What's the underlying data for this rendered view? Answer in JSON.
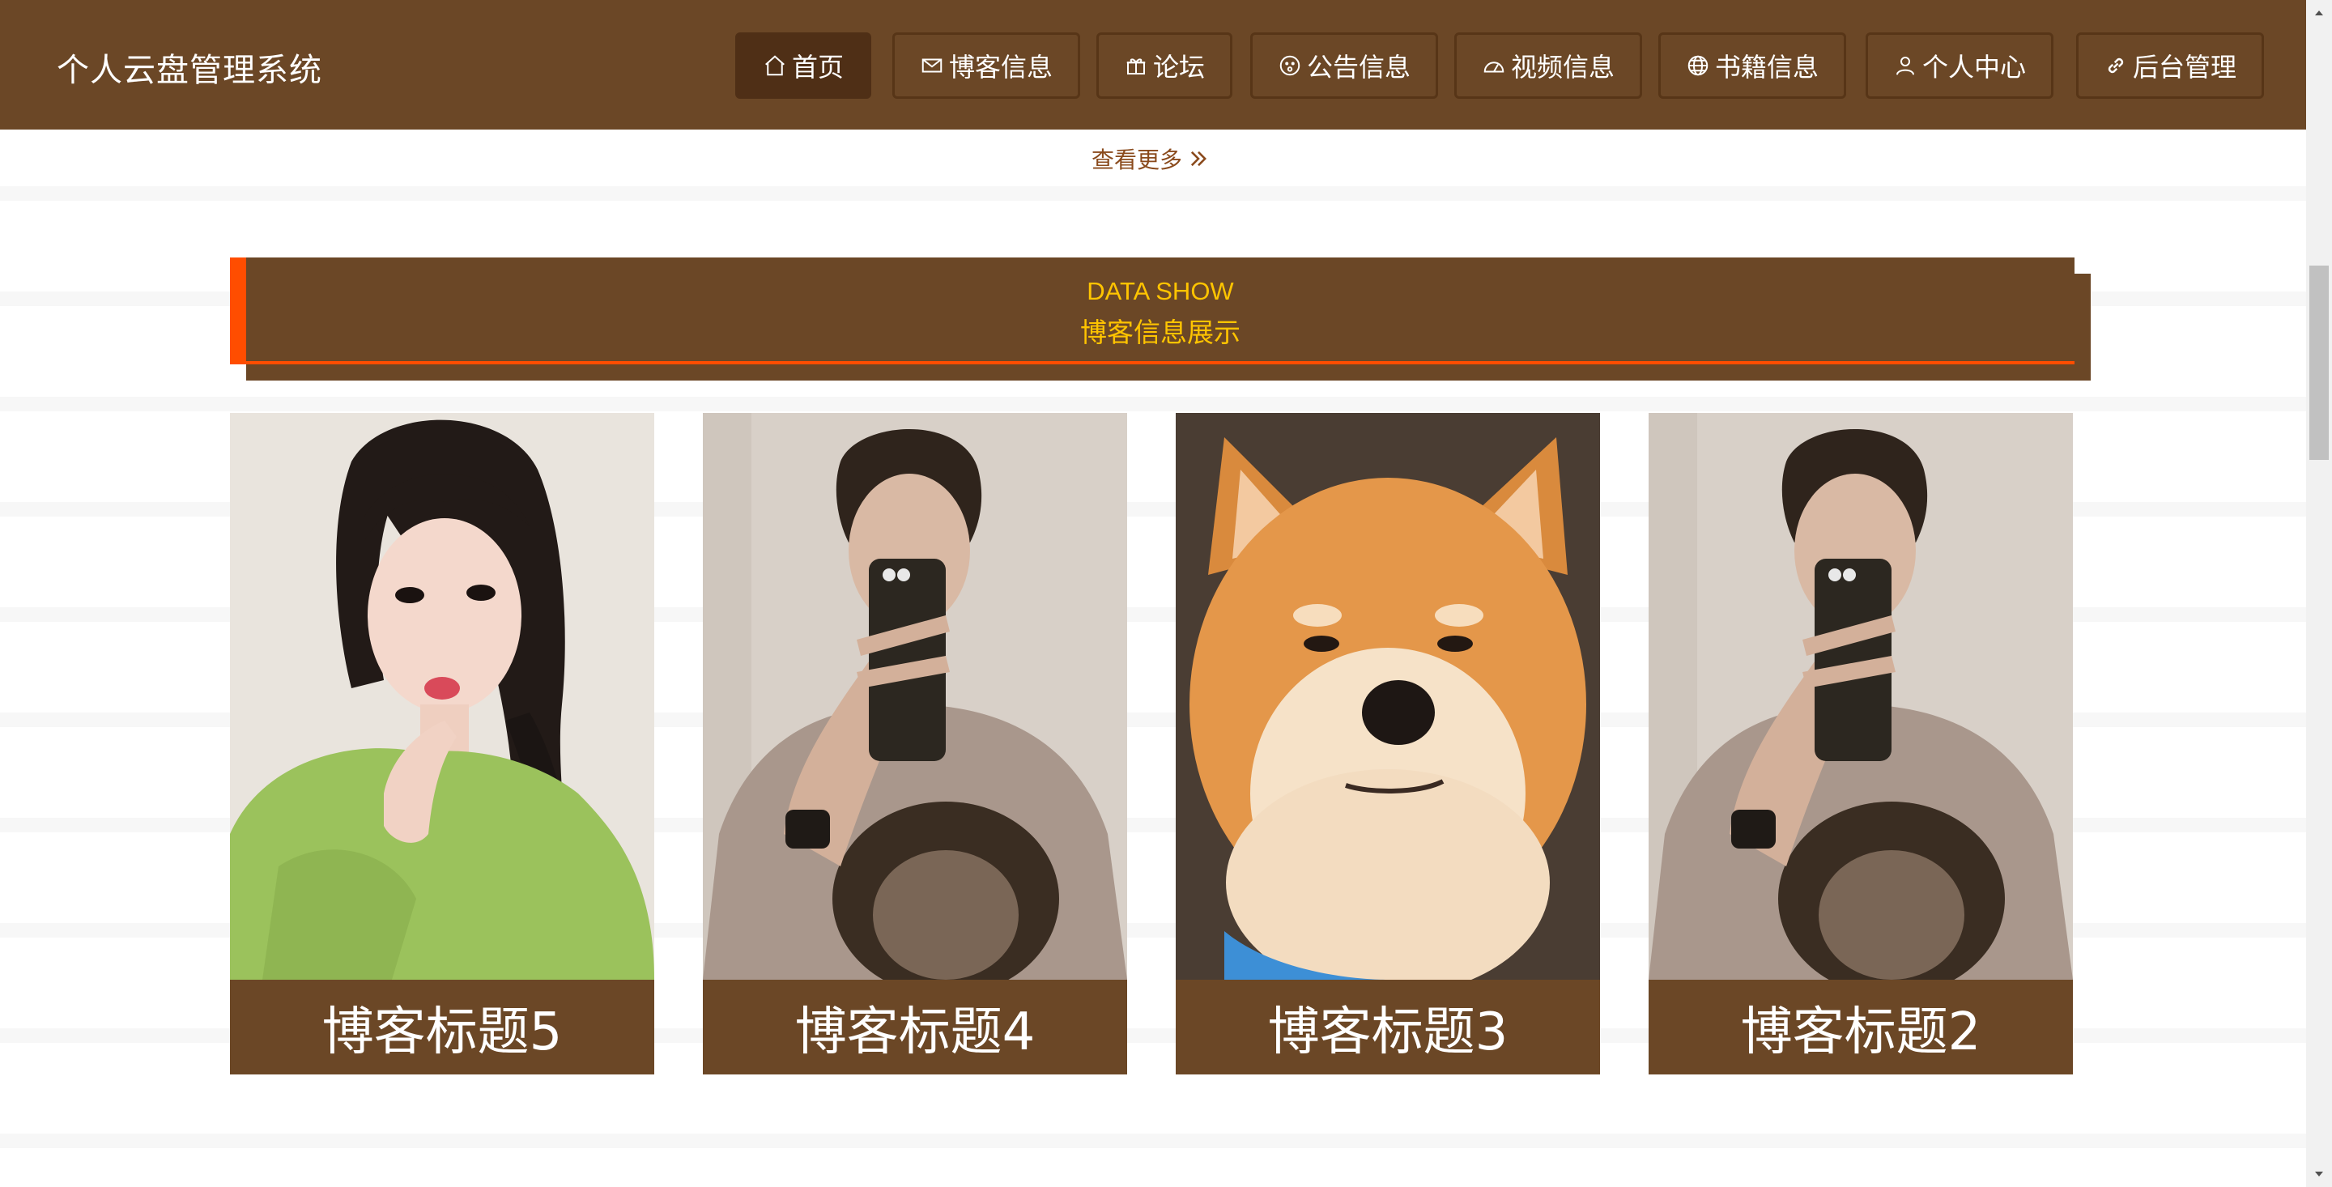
{
  "app": {
    "title": "个人云盘管理系统"
  },
  "nav": {
    "items": [
      {
        "label": "首页",
        "icon": "home-icon",
        "active": true
      },
      {
        "label": "博客信息",
        "icon": "mail-icon",
        "active": false
      },
      {
        "label": "论坛",
        "icon": "gift-icon",
        "active": false
      },
      {
        "label": "公告信息",
        "icon": "smile-icon",
        "active": false
      },
      {
        "label": "视频信息",
        "icon": "dashboard-icon",
        "active": false
      },
      {
        "label": "书籍信息",
        "icon": "globe-icon",
        "active": false
      },
      {
        "label": "个人中心",
        "icon": "user-icon",
        "active": false
      },
      {
        "label": "后台管理",
        "icon": "link-icon",
        "active": false
      }
    ]
  },
  "more": {
    "label": "查看更多"
  },
  "section": {
    "title_en": "DATA SHOW",
    "title_cn": "博客信息展示"
  },
  "cards": [
    {
      "title": "博客标题5",
      "image": "girl-green-sweater-photo"
    },
    {
      "title": "博客标题4",
      "image": "guy-mirror-selfie-photo"
    },
    {
      "title": "博客标题3",
      "image": "shiba-dog-photo"
    },
    {
      "title": "博客标题2",
      "image": "guy-mirror-selfie-photo"
    }
  ],
  "colors": {
    "brand": "#6b4726",
    "accent_orange": "#ff4d00",
    "accent_yellow": "#ffc400",
    "link": "#8a4a1c"
  }
}
